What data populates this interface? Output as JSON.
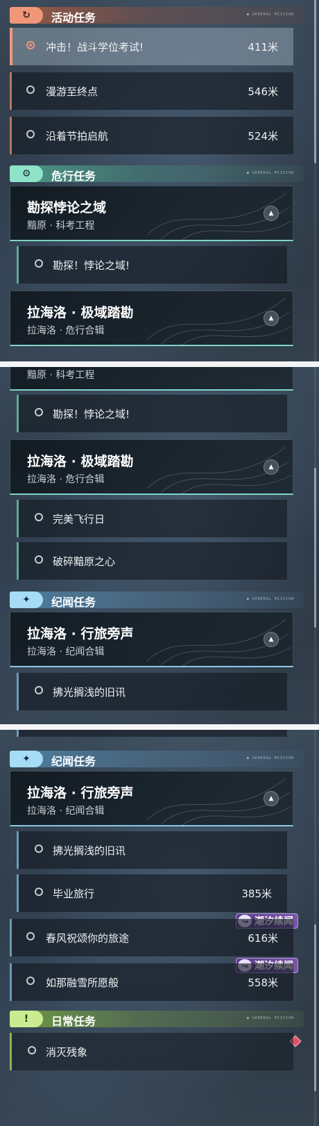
{
  "panel1": {
    "activity": {
      "title": "活动任务",
      "sub": "● GENERAL MISSION",
      "items": [
        {
          "label": "冲击！战斗学位考试!",
          "dist": "411米"
        },
        {
          "label": "漫游至终点",
          "dist": "546米"
        },
        {
          "label": "沿着节拍启航",
          "dist": "524米"
        }
      ]
    },
    "danger": {
      "title": "危行任务",
      "sub": "● GENERAL MISSION",
      "group1": {
        "title": "勘探悖论之域",
        "sub": "黯原 · 科考工程"
      },
      "group1_item": "勘探！悖论之域!",
      "group2": {
        "title": "拉海洛 · 极域踏勘",
        "sub": "拉海洛 · 危行合辑"
      }
    }
  },
  "panel2": {
    "cut_sub": "黯原 · 科考工程",
    "item1": "勘探！悖论之域!",
    "group": {
      "title": "拉海洛 · 极域踏勘",
      "sub": "拉海洛 · 危行合辑"
    },
    "item2": "完美飞行日",
    "item3": "破碎黯原之心",
    "chron": {
      "title": "纪闻任务",
      "sub": "● GENERAL MISSION"
    },
    "chron_group": {
      "title": "拉海洛 · 行旅旁声",
      "sub": "拉海洛 · 纪闻合辑"
    },
    "chron_item": "拂光搁浅的旧讯"
  },
  "panel3": {
    "chron": {
      "title": "纪闻任务",
      "sub": "● GENERAL MISSION"
    },
    "chron_group": {
      "title": "拉海洛 · 行旅旁声",
      "sub": "拉海洛 · 纪闻合辑"
    },
    "items": [
      {
        "label": "拂光搁浅的旧讯",
        "dist": ""
      },
      {
        "label": "毕业旅行",
        "dist": "385米"
      },
      {
        "label": "春风祝颂你的旅途",
        "dist": "616米"
      },
      {
        "label": "如那融雪所愿般",
        "dist": "558米"
      }
    ],
    "tag_label": "潮汐续闻",
    "daily": {
      "title": "日常任务",
      "sub": "● GENERAL MISSION"
    },
    "daily_item": "消灭残象"
  },
  "icons": {
    "activity": "refresh-icon",
    "danger": "gear-icon",
    "chron": "sparkle-icon",
    "daily": "exclamation-icon",
    "collapse": "triangle-up-icon",
    "tag": "tide-icon",
    "marker": "diamond-icon"
  },
  "colors": {
    "activity": "#f0977a",
    "danger": "#8fe3c8",
    "chron": "#a6dcf5",
    "daily": "#c9ec90",
    "tag": "#7b56a8",
    "marker": "#e0546b"
  }
}
